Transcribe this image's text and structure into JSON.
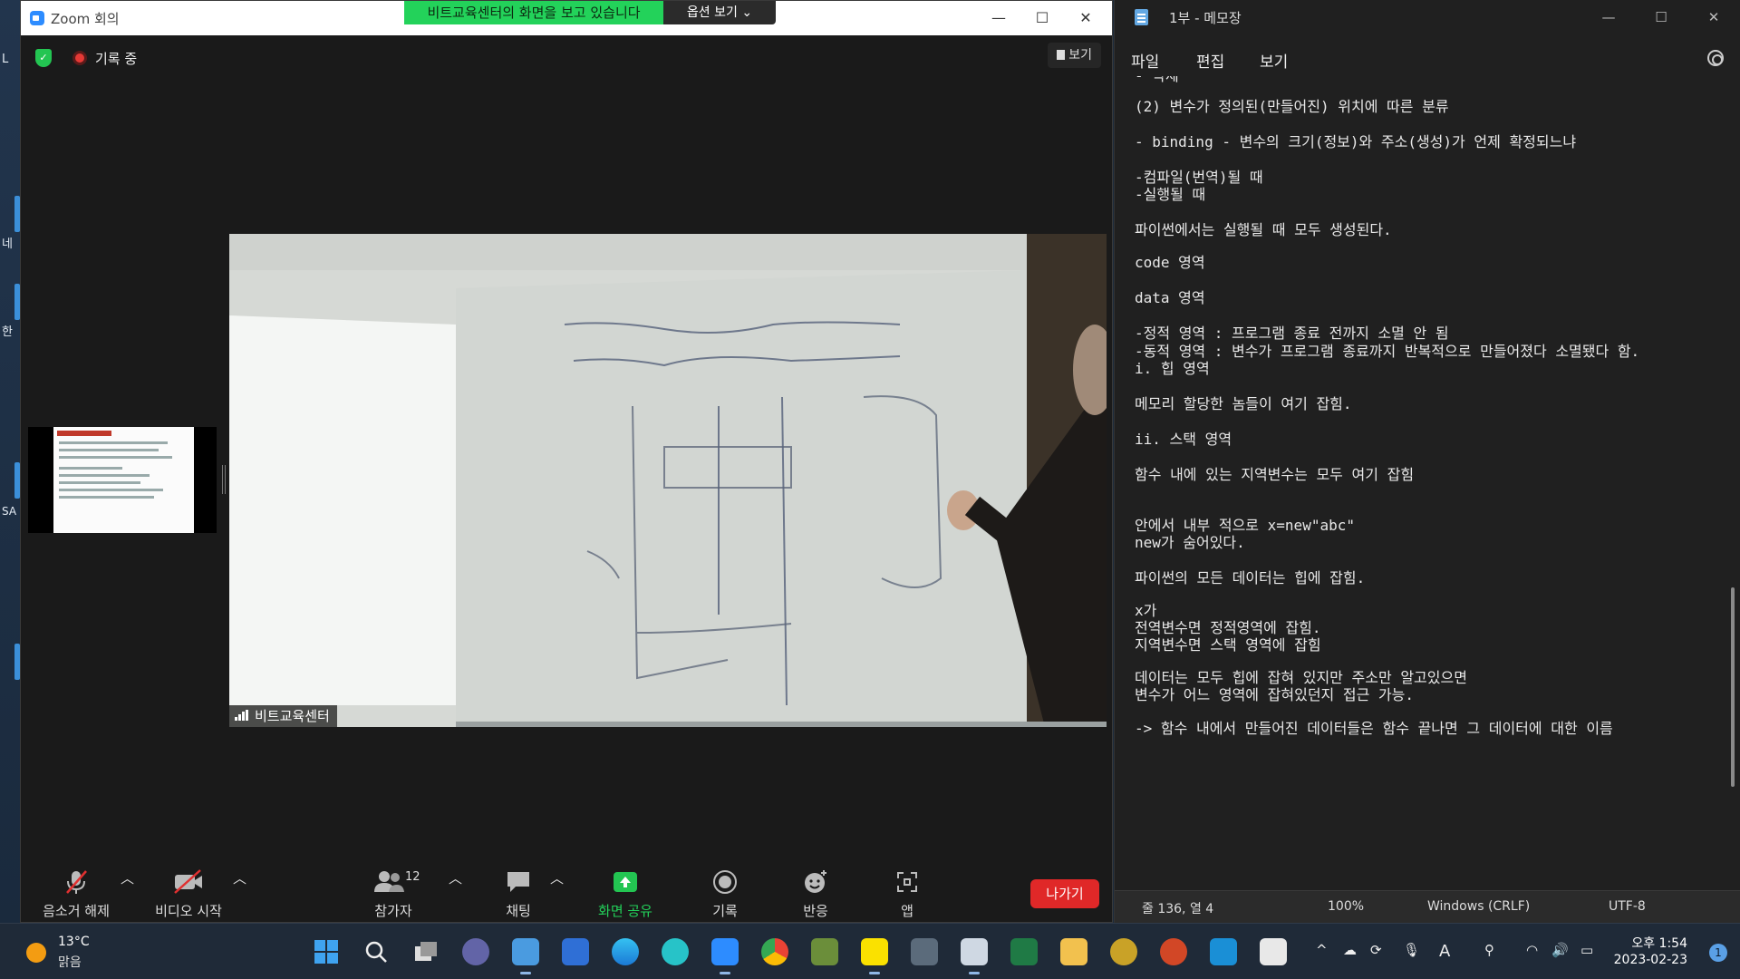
{
  "desktop": {
    "icon_labels": [
      "L",
      "네",
      "한",
      "SA"
    ]
  },
  "zoom": {
    "window_title": "Zoom 회의",
    "share_banner": "비트교육센터의 화면을 보고 있습니다",
    "options_label": "옵션 보기 ⌄",
    "recording_label": "기록 중",
    "view_label": "보기",
    "participant_name": "비트교육센터",
    "toolbar": {
      "unmute": "음소거 해제",
      "start_video": "비디오 시작",
      "participants": "참가자",
      "participants_count": "12",
      "chat": "채팅",
      "share_screen": "화면 공유",
      "record": "기록",
      "reactions": "반응",
      "apps": "앱",
      "leave": "나가기"
    },
    "accent_color": "#2d8cff",
    "share_color": "#23d25a",
    "leave_color": "#e02828"
  },
  "notepad": {
    "window_title": "1부 - 메모장",
    "menu": [
      "파일",
      "편집",
      "보기"
    ],
    "lines": [
      "- 삭제",
      "(2) 변수가 정의된(만들어진) 위치에 따른 분류",
      "- binding - 변수의 크기(정보)와 주소(생성)가 언제 확정되느냐",
      "-컴파일(번역)될 때",
      "-실행될 때",
      "파이썬에서는 실행될 때 모두 생성된다.",
      "code 영역",
      "data 영역",
      "-정적 영역 : 프로그램 종료 전까지 소멸 안 됨",
      "-동적 영역 : 변수가 프로그램 종료까지 반복적으로 만들어졌다 소멸됐다 함.",
      "i. 힙 영역",
      "메모리 할당한 놈들이 여기 잡힘.",
      "ii. 스택 영역",
      "함수 내에 있는 지역변수는 모두 여기 잡힘",
      "안에서 내부 적으로 x=new\"abc\"",
      "new가 숨어있다.",
      "파이썬의 모든 데이터는 힙에 잡힘.",
      "x가",
      "전역변수면 정적영역에 잡힘.",
      "지역변수면 스택 영역에 잡힘",
      "데이터는 모두 힙에 잡혀 있지만 주소만 알고있으면",
      "변수가 어느 영역에 잡혀있던지 접근 가능.",
      "-> 함수 내에서 만들어진 데이터들은 함수 끝나면 그 데이터에 대한 이름"
    ],
    "status": {
      "position": "줄 136, 열 4",
      "zoom": "100%",
      "line_ending": "Windows (CRLF)",
      "encoding": "UTF-8"
    }
  },
  "taskbar": {
    "weather_temp": "13°C",
    "weather_cond": "맑음",
    "ime_indicator": "A",
    "clock_time": "오후 1:54",
    "clock_date": "2023-02-23",
    "notification_count": "1",
    "apps": [
      "start-icon",
      "search-icon",
      "task-view-icon",
      "teams-chat-icon",
      "notepad-icon",
      "store-icon",
      "edge-icon",
      "app-icon",
      "zoom-icon",
      "chrome-icon",
      "minecraft-icon",
      "kakaotalk-icon",
      "calculator-icon",
      "snipping-tool-icon",
      "excel-icon",
      "file-explorer-icon",
      "app-icon",
      "powerpoint-icon",
      "app-icon",
      "app-icon"
    ]
  }
}
